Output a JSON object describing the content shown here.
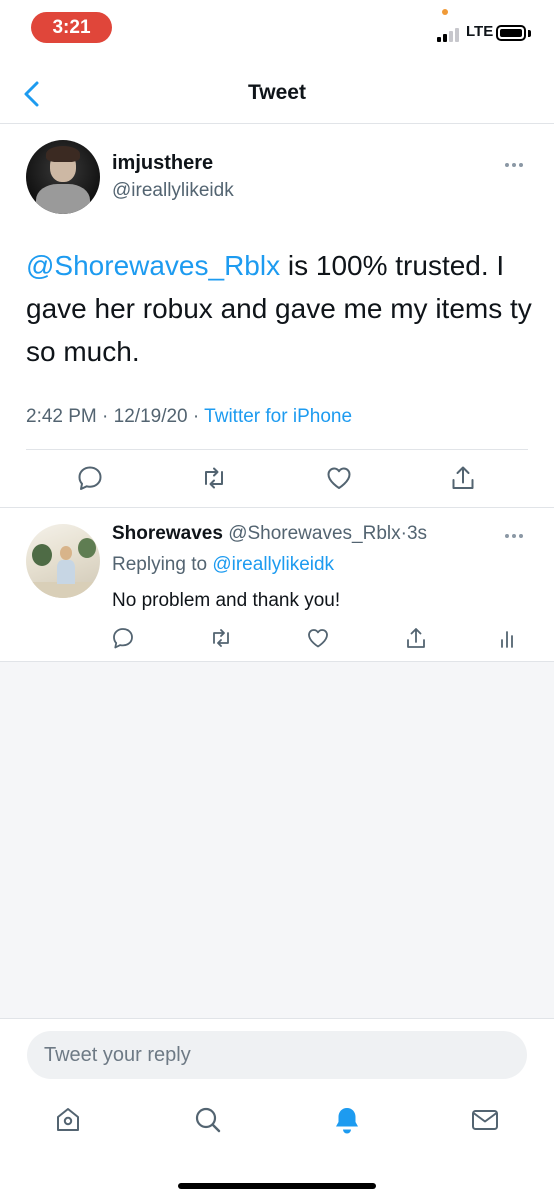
{
  "status_bar": {
    "time": "3:21",
    "network": "LTE"
  },
  "header": {
    "title": "Tweet",
    "back_icon": "chevron-left-icon"
  },
  "main_tweet": {
    "display_name": "imjusthere",
    "handle": "@ireallylikeidk",
    "mention": "@Shorewaves_Rblx",
    "text": " is 100% trusted. I gave her robux and gave me my items ty so much.",
    "time": "2:42 PM",
    "date": "12/19/20",
    "source": "Twitter for iPhone",
    "separator": "·",
    "actions": [
      "reply-icon",
      "retweet-icon",
      "like-icon",
      "share-icon"
    ]
  },
  "reply": {
    "display_name": "Shorewaves",
    "handle": "@Shorewaves_Rblx",
    "age": "3s",
    "replying_prefix": "Replying to",
    "replying_to": "@ireallylikeidk",
    "text": "No problem and thank you!",
    "actions": [
      "reply-icon",
      "retweet-icon",
      "like-icon",
      "share-icon",
      "analytics-icon"
    ]
  },
  "composer": {
    "placeholder": "Tweet your reply"
  },
  "tabbar": {
    "items": [
      "home-icon",
      "search-icon",
      "notifications-icon",
      "messages-icon"
    ],
    "active": "notifications-icon"
  },
  "colors": {
    "accent": "#1d9bf0",
    "text": "#0f1419",
    "secondary": "#536471",
    "divider": "#e1e4e8",
    "time_pill": "#e0463a"
  }
}
